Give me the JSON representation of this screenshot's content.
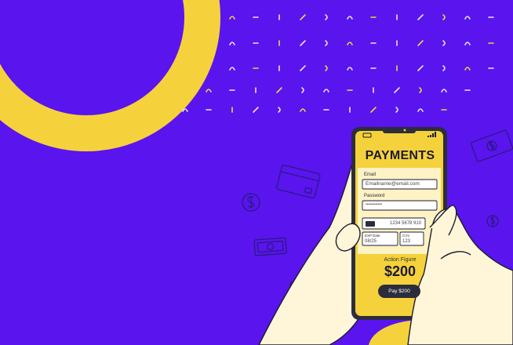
{
  "colors": {
    "background": "#5a14ee",
    "accent_yellow": "#f5d23c",
    "phone_screen": "#f5d23c",
    "ink": "#1c1a2e",
    "skin": "#fff6d9"
  },
  "icons": [
    "battery-icon",
    "signal-icon",
    "card-chip-icon",
    "dollar-coin-icon",
    "banknote-icon",
    "credit-card-icon"
  ],
  "payment_form": {
    "title": "PAYMENTS",
    "email_label": "Email",
    "email_value": "Emailname@email.com",
    "password_label": "Password",
    "password_value": "••••••••••••",
    "card_number": "1234 5678 910",
    "expiry_label": "EXP Date",
    "expiry_value": "08/25",
    "cvv_label": "CVV",
    "cvv_value": "123",
    "amount_label": "Action Figure",
    "amount_value": "$200",
    "pay_button": "Pay $200"
  }
}
